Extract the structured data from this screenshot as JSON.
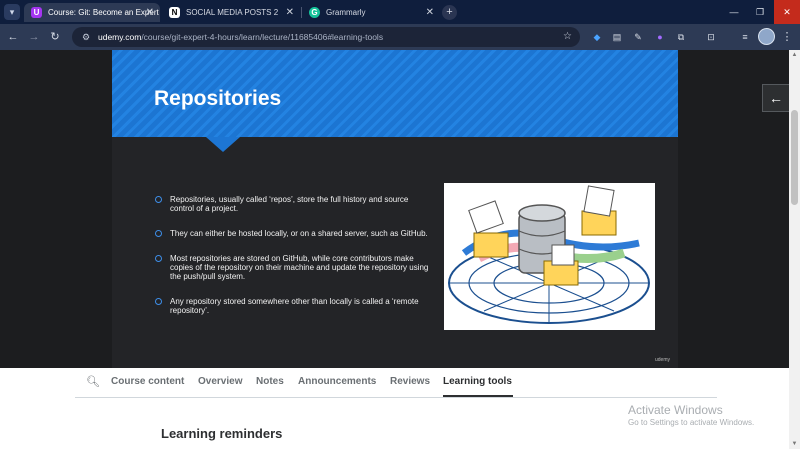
{
  "browser": {
    "tabs": [
      {
        "title": "Course: Git: Become an Expert",
        "active": true
      },
      {
        "title": "SOCIAL MEDIA POSTS 2",
        "active": false
      },
      {
        "title": "Grammarly",
        "active": false
      }
    ],
    "url_host": "udemy.com",
    "url_path": "/course/git-expert-4-hours/learn/lecture/11685406#learning-tools",
    "colors": {
      "tabbar": "#0f1e3d",
      "toolbar": "#2d3a55",
      "close": "#c42b1c"
    }
  },
  "slide": {
    "title": "Repositories",
    "bullets": [
      "Repositories, usually called ‘repos’, store the full history and source control of a project.",
      "They can either be hosted locally, or on a shared server, such as GitHub.",
      "Most repositories are stored on GitHub, while core contributors make copies of the repository on their machine and update the repository using the push/pull system.",
      "Any repository stored somewhere other than locally is called a ‘remote repository’."
    ],
    "watermark": "udemy",
    "colors": {
      "header": "#1c75d2",
      "bullet_ring": "#3d8ee8",
      "background": "#232427"
    }
  },
  "course_tabs": {
    "items": [
      "Course content",
      "Overview",
      "Notes",
      "Announcements",
      "Reviews",
      "Learning tools"
    ],
    "active": "Learning tools"
  },
  "section": {
    "heading": "Learning reminders"
  },
  "windows_watermark": {
    "title": "Activate Windows",
    "subtitle": "Go to Settings to activate Windows."
  }
}
